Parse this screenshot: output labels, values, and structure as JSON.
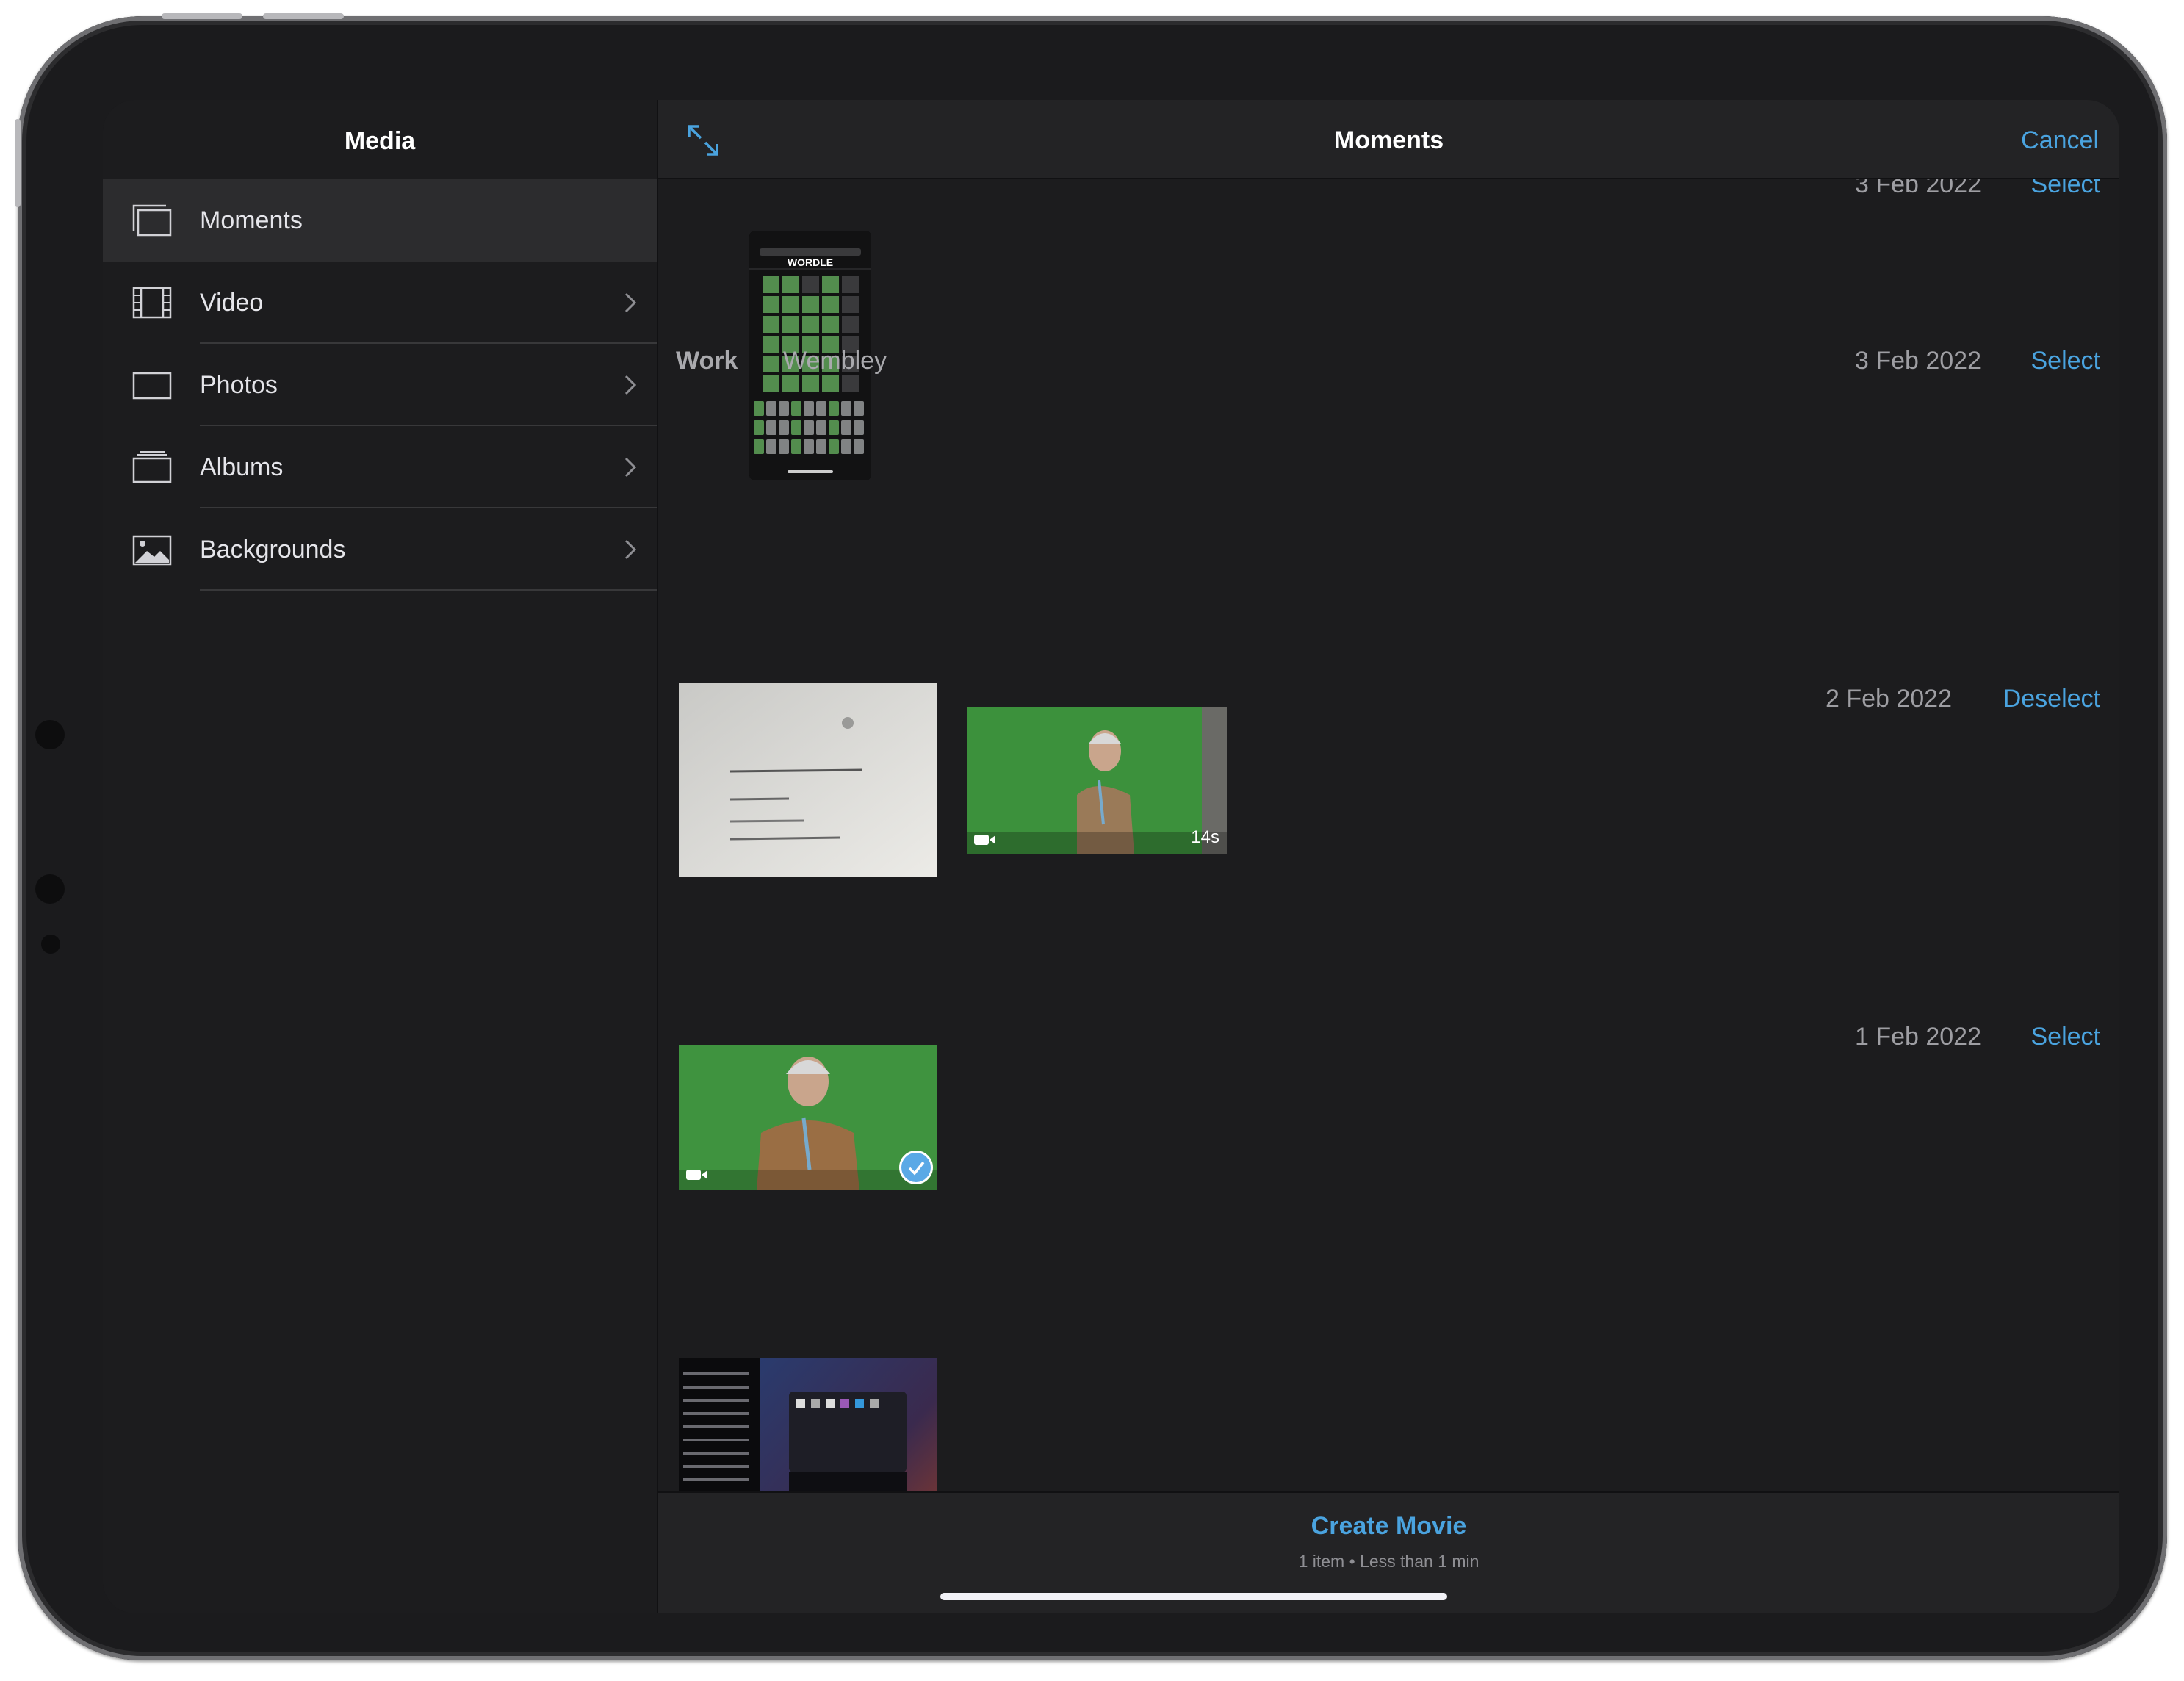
{
  "sidebar": {
    "title": "Media",
    "items": [
      {
        "label": "Moments",
        "icon": "moments-icon"
      },
      {
        "label": "Video",
        "icon": "film-icon"
      },
      {
        "label": "Photos",
        "icon": "photo-frame-icon"
      },
      {
        "label": "Albums",
        "icon": "albums-icon"
      },
      {
        "label": "Backgrounds",
        "icon": "image-icon"
      }
    ]
  },
  "navbar": {
    "title": "Moments",
    "cancel_label": "Cancel"
  },
  "sections": [
    {
      "date": "3 Feb 2022",
      "action": "Select"
    },
    {
      "location_primary": "Work",
      "location_secondary": "Wembley",
      "date": "3 Feb 2022",
      "action": "Select",
      "video_duration": "14s"
    },
    {
      "date": "2 Feb 2022",
      "action": "Deselect"
    },
    {
      "date": "1 Feb 2022",
      "action": "Select"
    }
  ],
  "thumbnail_text": {
    "wordle_title": "WORDLE"
  },
  "bottom": {
    "create_label": "Create Movie",
    "summary": "1 item • Less than 1 min"
  },
  "colors": {
    "accent": "#4aa3df",
    "background": "#1c1c1e",
    "bar": "#232325"
  }
}
